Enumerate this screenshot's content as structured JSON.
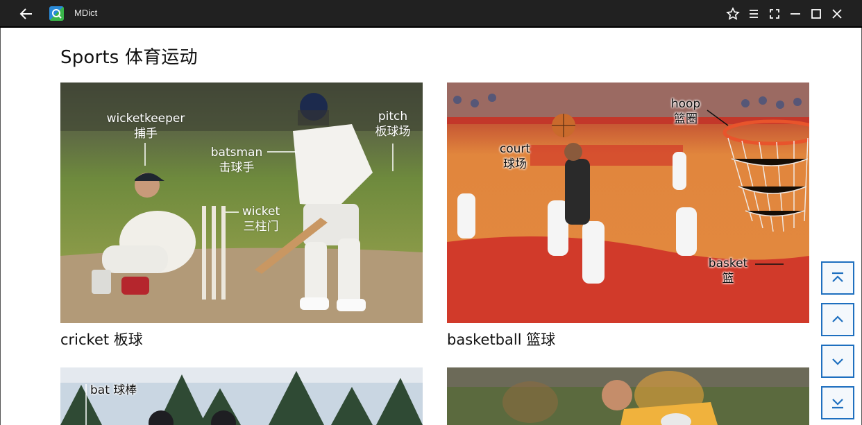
{
  "window": {
    "app_name": "MDict"
  },
  "page": {
    "heading": "Sports  体育运动"
  },
  "entries": [
    {
      "caption": "cricket  板球",
      "labels": {
        "wicketkeeper_en": "wicketkeeper",
        "wicketkeeper_zh": "捕手",
        "batsman_en": "batsman",
        "batsman_zh": "击球手",
        "pitch_en": "pitch",
        "pitch_zh": "板球场",
        "wicket_en": "wicket",
        "wicket_zh": "三柱门"
      }
    },
    {
      "caption": "basketball  篮球",
      "labels": {
        "hoop_en": "hoop",
        "hoop_zh": "篮圈",
        "court_en": "court",
        "court_zh": "球场",
        "basket_en": "basket",
        "basket_zh": "篮"
      }
    },
    {
      "labels": {
        "bat": "bat 球棒"
      }
    },
    {
      "labels": {}
    }
  ],
  "icons": {
    "back": "back-arrow-icon",
    "app": "mdict-app-icon",
    "pin": "pin-icon",
    "menu": "menu-icon",
    "fullscreen": "fullscreen-icon",
    "minimize": "minimize-icon",
    "maximize": "maximize-icon",
    "close": "close-icon",
    "scroll_top": "scroll-to-top-icon",
    "scroll_up": "scroll-up-icon",
    "scroll_down": "scroll-down-icon",
    "scroll_bottom": "scroll-to-bottom-icon"
  },
  "colors": {
    "titlebar": "#212121",
    "nav_border": "#1e6fbf"
  }
}
